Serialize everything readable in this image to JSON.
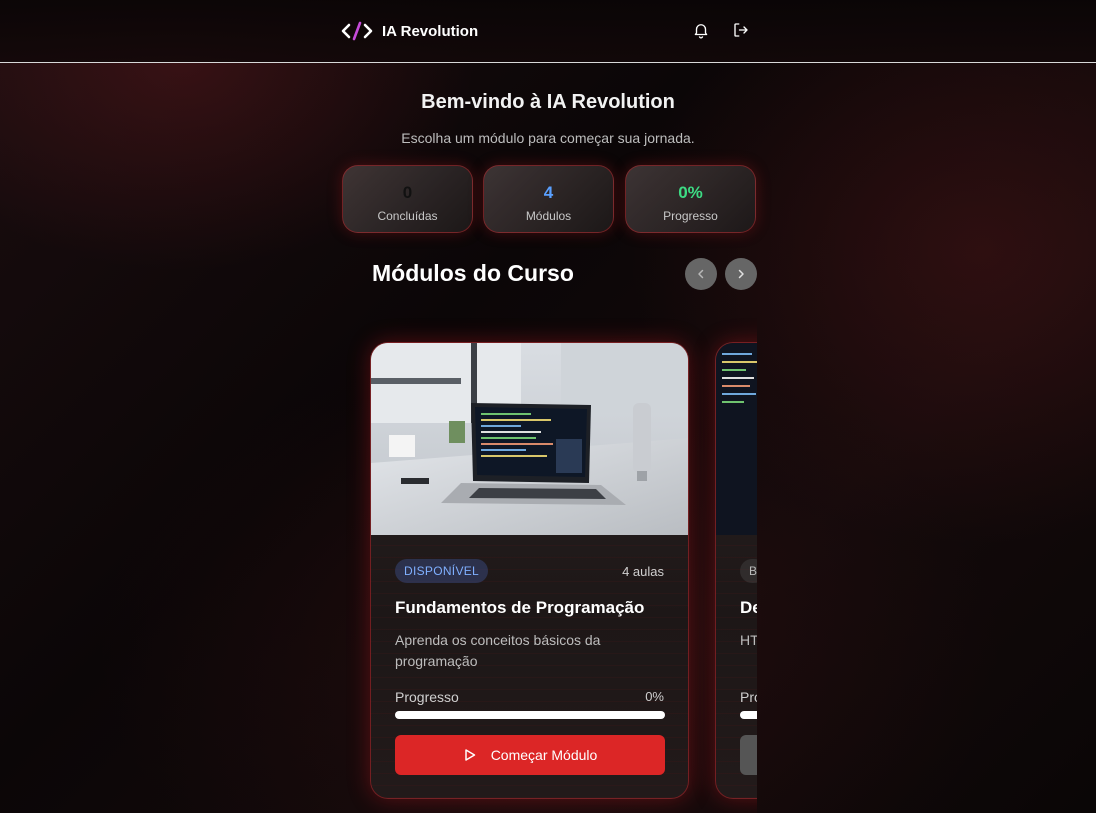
{
  "header": {
    "brand_name": "IA Revolution",
    "icons": [
      "code-icon",
      "bell-icon",
      "logout-icon"
    ]
  },
  "welcome": {
    "title": "Bem-vindo à IA Revolution",
    "subtitle": "Escolha um módulo para começar sua jornada."
  },
  "stats": [
    {
      "value": "0",
      "label": "Concluídas",
      "color": "#111111"
    },
    {
      "value": "4",
      "label": "Módulos",
      "color": "#5aa0ff"
    },
    {
      "value": "0%",
      "label": "Progresso",
      "color": "#3ddc84"
    }
  ],
  "section": {
    "title": "Módulos do Curso"
  },
  "modules": [
    {
      "status": "DISPONÍVEL",
      "lessons": "4 aulas",
      "title": "Fundamentos de Programação",
      "description": "Aprenda os conceitos básicos da programação",
      "progress_label": "Progresso",
      "progress_text": "0%",
      "progress": 0,
      "button_label": "Começar Módulo"
    },
    {
      "status": "B",
      "title": "De",
      "description": "HT mo",
      "progress_label": "Pro"
    }
  ],
  "colors": {
    "accent": "#dc2626",
    "badge_text": "#7fb0ff"
  }
}
